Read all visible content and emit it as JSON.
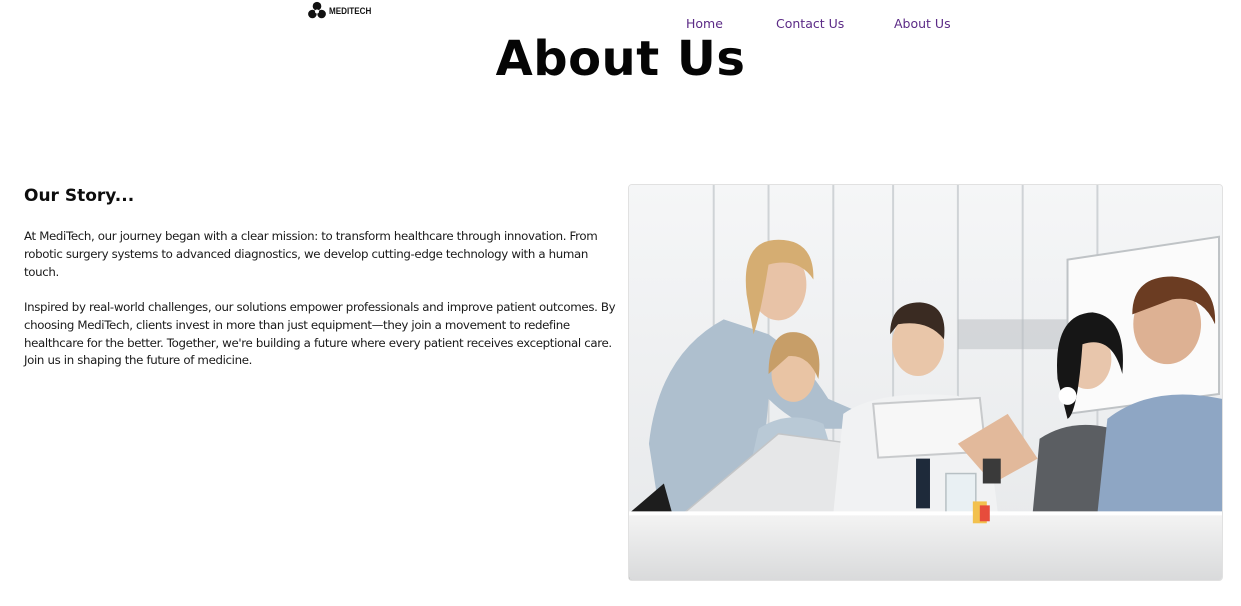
{
  "brand": {
    "name": "MEDITECH",
    "logo_icon": "trefoil-logo-icon"
  },
  "nav": {
    "items": [
      {
        "label": "Home"
      },
      {
        "label": "Contact Us"
      },
      {
        "label": "About Us"
      }
    ],
    "link_color": "#5b2a86"
  },
  "page": {
    "title": "About Us"
  },
  "story": {
    "heading": "Our Story...",
    "paragraphs": [
      "At MediTech, our journey began with a clear mission: to transform healthcare through innovation. From robotic surgery systems to advanced diagnostics, we develop cutting-edge technology with a human touch.",
      "Inspired by real-world challenges, our solutions empower professionals and improve patient outcomes. By choosing MediTech, clients invest in more than just equipment—they join a movement to redefine healthcare for the better. Together, we're building a future where every patient receives exceptional care. Join us in shaping the future of medicine."
    ]
  },
  "image": {
    "subject": "team-meeting-photo"
  }
}
